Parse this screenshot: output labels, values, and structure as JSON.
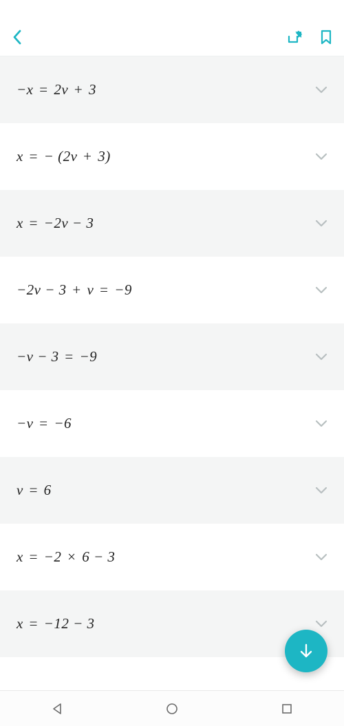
{
  "status": {
    "left": "",
    "right": ""
  },
  "header": {
    "back_icon": "back",
    "share_icon": "share",
    "bookmark_icon": "bookmark"
  },
  "steps": [
    {
      "equation_html": "−<i>x</i> = 2<i>v</i> + 3",
      "alt": true
    },
    {
      "equation_html": "<i>x</i> = − (2<i>v</i> + 3)",
      "alt": false
    },
    {
      "equation_html": "<i>x</i> = −2<i>v</i> − 3",
      "alt": true
    },
    {
      "equation_html": "−2<i>v</i> − 3 + <i>v</i> = −9",
      "alt": false
    },
    {
      "equation_html": "−<i>v</i> − 3 = −9",
      "alt": true
    },
    {
      "equation_html": "−<i>v</i> = −6",
      "alt": false
    },
    {
      "equation_html": "<i>v</i> = 6",
      "alt": true
    },
    {
      "equation_html": "<i>x</i> = −2 × 6 − 3",
      "alt": false
    },
    {
      "equation_html": "<i>x</i> = −12 − 3",
      "alt": true
    }
  ],
  "fab": {
    "icon": "download"
  },
  "nav": {
    "back": "back",
    "home": "home",
    "recent": "recent"
  },
  "colors": {
    "accent": "#1db6c4",
    "chevron": "#b8bfc0"
  }
}
